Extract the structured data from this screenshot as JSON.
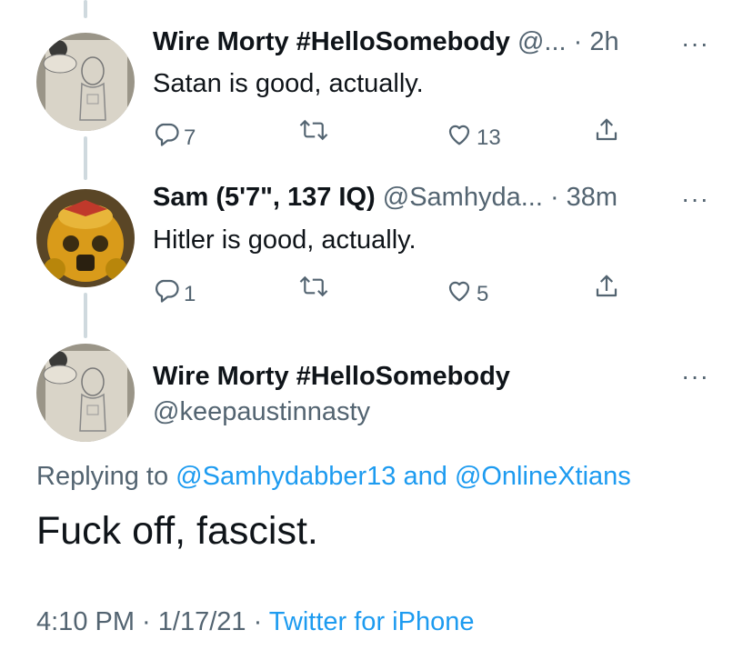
{
  "tweets": [
    {
      "name": "Wire Morty #HelloSomebody",
      "handle": "@...",
      "sep": " ·",
      "time": "2h",
      "text": "Satan is good, actually.",
      "replies": "7",
      "retweets": "",
      "likes": "13"
    },
    {
      "name": "Sam (5'7\", 137 IQ)",
      "handle": "@Samhyda...",
      "sep": " ·",
      "time": "38m",
      "text": "Hitler is good, actually.",
      "replies": "1",
      "retweets": "",
      "likes": "5"
    }
  ],
  "main_tweet": {
    "name": "Wire Morty #HelloSomebody",
    "handle": "@keepaustinnasty",
    "replying_prefix": "Replying to",
    "reply_to_1": "@Samhydabber13",
    "reply_and": "and",
    "reply_to_2": "@OnlineXtians",
    "text": "Fuck off, fascist.",
    "time": "4:10 PM",
    "date": "1/17/21",
    "source": "Twitter for iPhone"
  },
  "icons": {
    "more": "more-icon",
    "reply": "reply-icon",
    "retweet": "retweet-icon",
    "like": "heart-icon",
    "share": "share-icon"
  },
  "colors": {
    "text": "#0f1419",
    "secondary": "#536471",
    "link": "#1d9bf0",
    "thread_line": "#cfd9de"
  },
  "more_glyph": "···",
  "meta_sep": " · "
}
